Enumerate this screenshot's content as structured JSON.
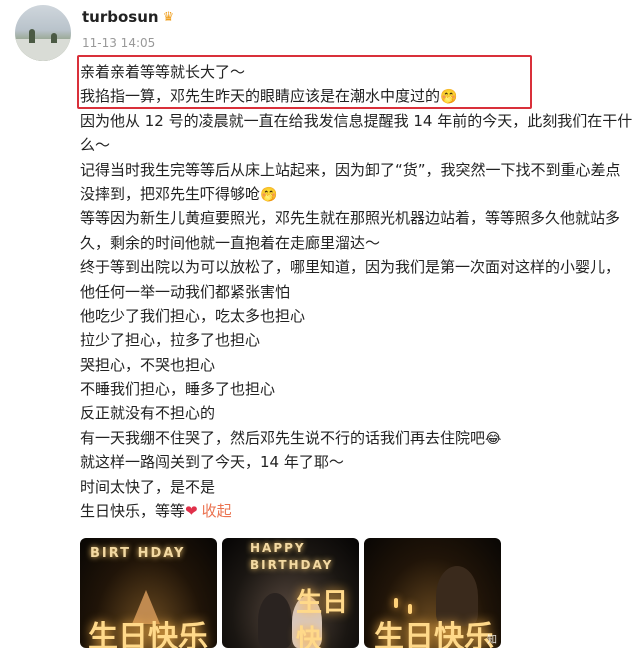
{
  "post": {
    "username": "turbosun",
    "timestamp": "11-13 14:05",
    "lines": [
      "亲着亲着等等就长大了～",
      "我掐指一算，邓先生昨天的眼睛应该是在潮水中度过的",
      "因为他从 12 号的凌晨就一直在给我发信息提醒我 14 年前的今天，此刻我们在干什",
      "么～",
      "记得当时我生完等等后从床上站起来，因为卸了“货”，我突然一下找不到重心差点",
      "没摔到，把邓先生吓得够呛",
      "等等因为新生儿黄疸要照光，邓先生就在那照光机器边站着，等等照多久他就站多",
      "久，剩余的时间他就一直抱着在走廊里溜达～",
      "终于等到出院以为可以放松了，哪里知道，因为我们是第一次面对这样的小婴儿，",
      "他任何一举一动我们都紧张害怕",
      "他吃少了我们担心，吃太多也担心",
      "拉少了担心，拉多了也担心",
      "哭担心，不哭也担心",
      "不睡我们担心，睡多了也担心",
      "反正就没有不担心的",
      "有一天我绷不住哭了，然后邓先生说不行的话我们再去住院吧",
      "就这样一路闯关到了今天，14 年了耶～",
      "时间太快了，是不是",
      "生日快乐，等等"
    ],
    "emoji_grin": "🤭",
    "emoji_cry": "😂",
    "heart": "❤",
    "collapse_label": "收起"
  },
  "photos": [
    {
      "caption_top": "BIRT HDAY",
      "caption_bottom": "生日快乐"
    },
    {
      "caption_top": "HAPPY BIRTHDAY",
      "caption_bottom": "生日快"
    },
    {
      "caption_top": "",
      "caption_bottom": "生日快乐"
    }
  ],
  "watermark": "知",
  "colors": {
    "highlight_border": "#d9303a",
    "collapse_link": "#eb7350",
    "timestamp": "#999999"
  }
}
